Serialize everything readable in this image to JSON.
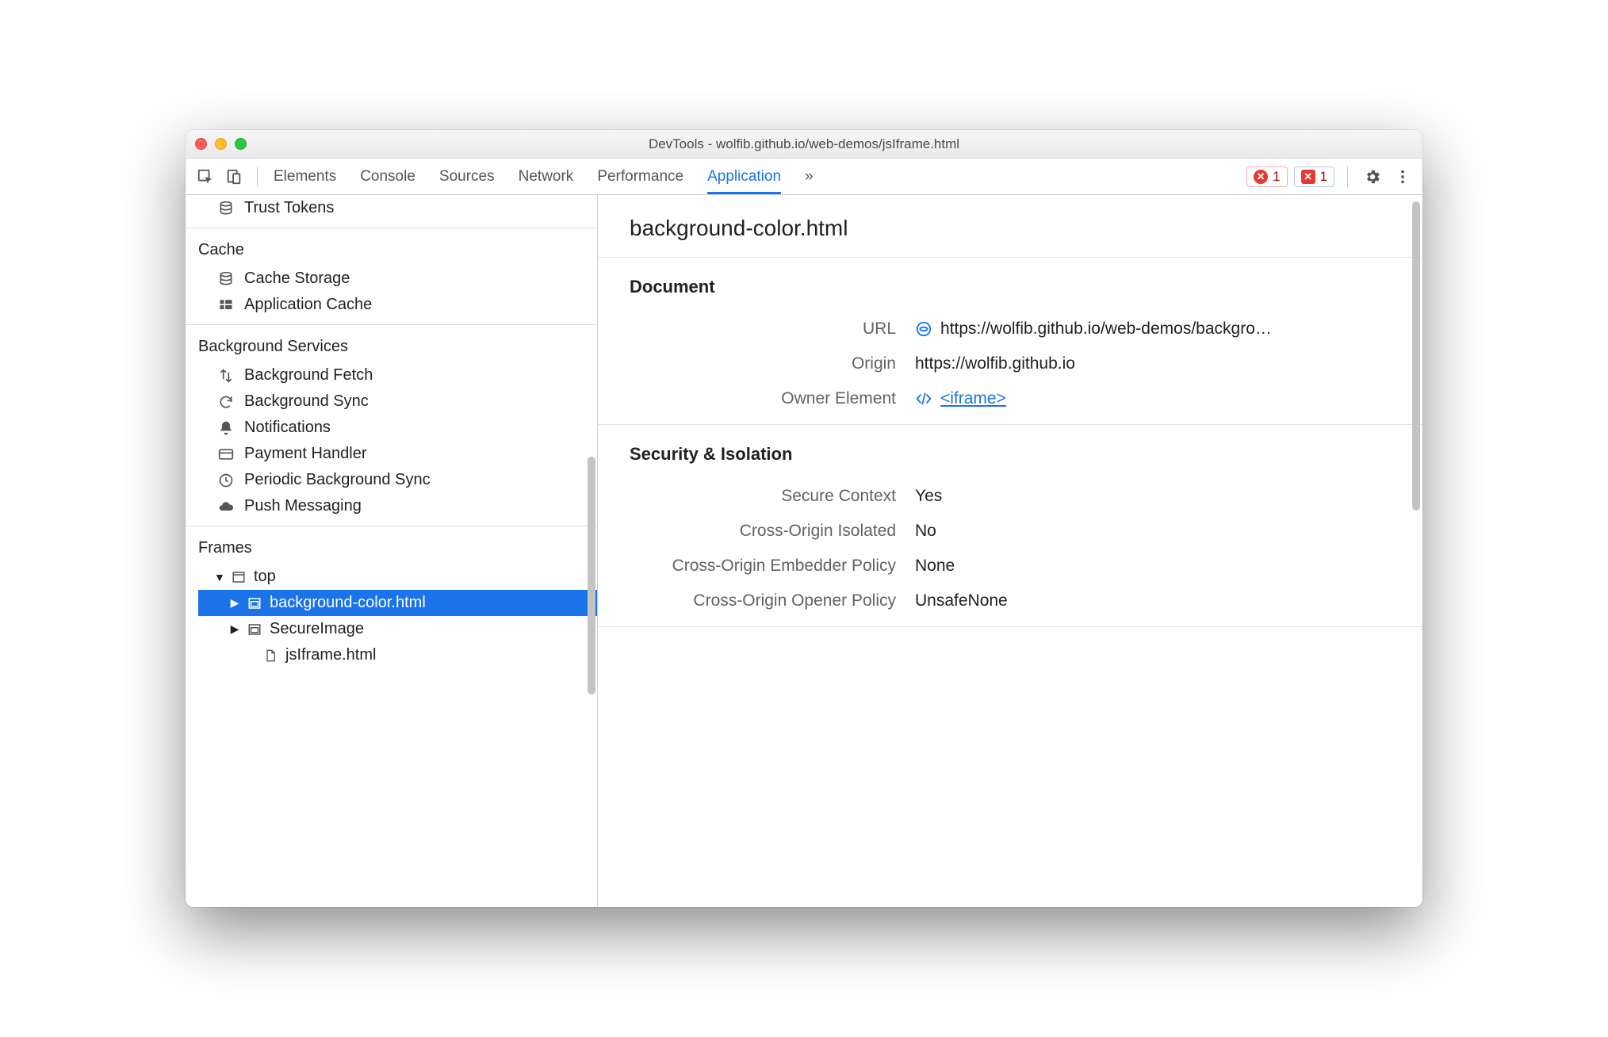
{
  "window": {
    "title": "DevTools - wolfib.github.io/web-demos/jsIframe.html"
  },
  "tabs": {
    "items": [
      "Elements",
      "Console",
      "Sources",
      "Network",
      "Performance",
      "Application"
    ],
    "active": "Application",
    "overflow_glyph": "»"
  },
  "badges": {
    "error_count": "1",
    "warn_count": "1"
  },
  "sidebar": {
    "trust_tokens": "Trust Tokens",
    "cache_header": "Cache",
    "cache_storage": "Cache Storage",
    "app_cache": "Application Cache",
    "bg_header": "Background Services",
    "bg_fetch": "Background Fetch",
    "bg_sync": "Background Sync",
    "notifications": "Notifications",
    "payment": "Payment Handler",
    "periodic": "Periodic Background Sync",
    "push": "Push Messaging",
    "frames_header": "Frames",
    "top": "top",
    "frame_bg": "background-color.html",
    "frame_secure": "SecureImage",
    "frame_js": "jsIframe.html"
  },
  "detail": {
    "title": "background-color.html",
    "doc_header": "Document",
    "url_label": "URL",
    "url_value": "https://wolfib.github.io/web-demos/backgro…",
    "origin_label": "Origin",
    "origin_value": "https://wolfib.github.io",
    "owner_label": "Owner Element",
    "owner_value": "<iframe>",
    "sec_header": "Security & Isolation",
    "secure_ctx_label": "Secure Context",
    "secure_ctx_value": "Yes",
    "coi_label": "Cross-Origin Isolated",
    "coi_value": "No",
    "coep_label": "Cross-Origin Embedder Policy",
    "coep_value": "None",
    "coop_label": "Cross-Origin Opener Policy",
    "coop_value": "UnsafeNone"
  }
}
